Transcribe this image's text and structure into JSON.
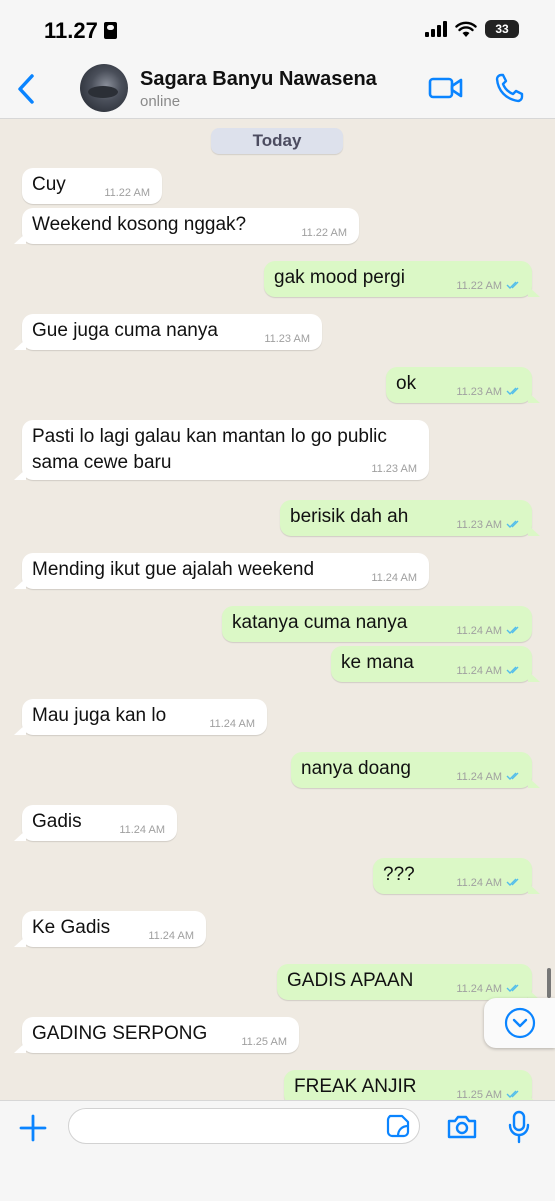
{
  "status_bar": {
    "time": "11.27",
    "battery": "33"
  },
  "header": {
    "contact_name": "Sagara Banyu Nawasena",
    "contact_status": "online"
  },
  "chat": {
    "day_label": "Today",
    "messages": [
      {
        "dir": "in",
        "text": "Cuy",
        "time": "11.22 AM",
        "tail": false
      },
      {
        "dir": "in",
        "text": "Weekend kosong nggak?",
        "time": "11.22 AM",
        "tail": true
      },
      {
        "dir": "out",
        "text": "gak mood pergi",
        "time": "11.22 AM",
        "tail": true
      },
      {
        "dir": "in",
        "text": "Gue juga cuma nanya",
        "time": "11.23 AM",
        "tail": true
      },
      {
        "dir": "out",
        "text": "ok",
        "time": "11.23 AM",
        "tail": true
      },
      {
        "dir": "in",
        "text": "Pasti lo lagi galau kan mantan lo go public\nsama cewe baru",
        "time": "11.23 AM",
        "tail": true
      },
      {
        "dir": "out",
        "text": "berisik dah ah",
        "time": "11.23 AM",
        "tail": true
      },
      {
        "dir": "in",
        "text": "Mending ikut gue ajalah weekend",
        "time": "11.24 AM",
        "tail": true
      },
      {
        "dir": "out",
        "text": "katanya cuma nanya",
        "time": "11.24 AM",
        "tail": false
      },
      {
        "dir": "out",
        "text": "ke mana",
        "time": "11.24 AM",
        "tail": true
      },
      {
        "dir": "in",
        "text": "Mau juga kan lo",
        "time": "11.24 AM",
        "tail": true
      },
      {
        "dir": "out",
        "text": "nanya doang",
        "time": "11.24 AM",
        "tail": true
      },
      {
        "dir": "in",
        "text": "Gadis",
        "time": "11.24 AM",
        "tail": true
      },
      {
        "dir": "out",
        "text": "???",
        "time": "11.24 AM",
        "tail": true
      },
      {
        "dir": "in",
        "text": "Ke Gadis",
        "time": "11.24 AM",
        "tail": true
      },
      {
        "dir": "out",
        "text": "GADIS APAAN",
        "time": "11.24 AM",
        "tail": true
      },
      {
        "dir": "in",
        "text": "GADING SERPONG",
        "time": "11.25 AM",
        "tail": true
      },
      {
        "dir": "out",
        "text": "FREAK ANJIR",
        "time": "11.25 AM",
        "tail": true
      }
    ]
  },
  "composer": {
    "input_value": ""
  },
  "icons": {
    "back": "chevron-left-icon",
    "video": "video-camera-icon",
    "call": "phone-icon",
    "plus": "plus-icon",
    "sticker": "sticker-icon",
    "camera": "camera-icon",
    "mic": "microphone-icon",
    "scroll_down": "chevron-down-circle-icon",
    "read": "double-check-icon"
  },
  "colors": {
    "accent": "#0a84ff",
    "outgoing_bubble": "#dbf8c6",
    "incoming_bubble": "#ffffff",
    "chat_background": "#efeae2",
    "read_ticks": "#53bdeb"
  }
}
